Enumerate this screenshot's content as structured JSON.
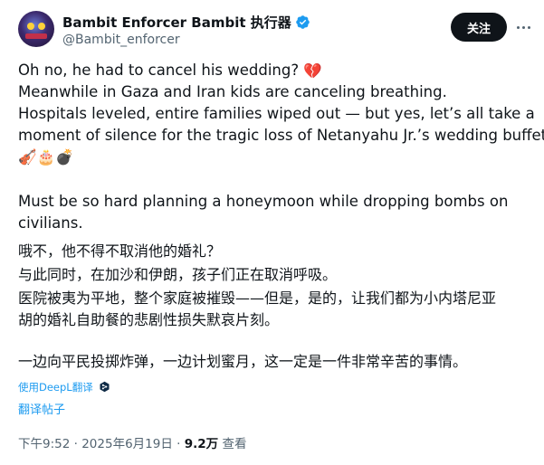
{
  "author": {
    "display_name": "Bambit Enforcer Bambit 执行器",
    "handle": "@Bambit_enforcer",
    "verified": true
  },
  "follow_label": "关注",
  "tweet": {
    "en_lines": [
      "Oh no, he had to cancel his wedding?",
      "Meanwhile in Gaza and Iran kids are canceling breathing.",
      "Hospitals leveled, entire families wiped out — but yes, let’s all take a",
      "moment of silence for the tragic loss of Netanyahu Jr.’s wedding buffet.",
      "Must be so hard planning a honeymoon while dropping bombs on",
      "civilians."
    ],
    "emoji_line1": "💔",
    "emoji_row": "🎻🎂💣",
    "zh_lines": [
      "哦不，他不得不取消他的婚礼？",
      "与此同时，在加沙和伊朗，孩子们正在取消呼吸。",
      "医院被夷为平地，整个家庭被摧毁——但是，是的，让我们都为小内塔尼亚",
      "胡的婚礼自助餐的悲剧性损失默哀片刻。",
      "一边向平民投掷炸弹，一边计划蜜月，这一定是一件非常辛苦的事情。"
    ]
  },
  "translation": {
    "deepl_label": "使用DeepL翻译",
    "translate_post_label": "翻译帖子"
  },
  "meta": {
    "time": "下午9:52",
    "date": "2025年6月19日",
    "views_count": "9.2万",
    "views_label": "查看",
    "separator": "·"
  },
  "colors": {
    "link": "#1d9bf0",
    "secondary_text": "#536471",
    "primary_text": "#0f1419",
    "button_bg": "#0f1419"
  },
  "icons": [
    "avatar-image",
    "verified-badge-icon",
    "more-options-icon",
    "deepl-logo-icon",
    "broken-heart-emoji",
    "violin-emoji",
    "cake-emoji",
    "bomb-emoji"
  ]
}
